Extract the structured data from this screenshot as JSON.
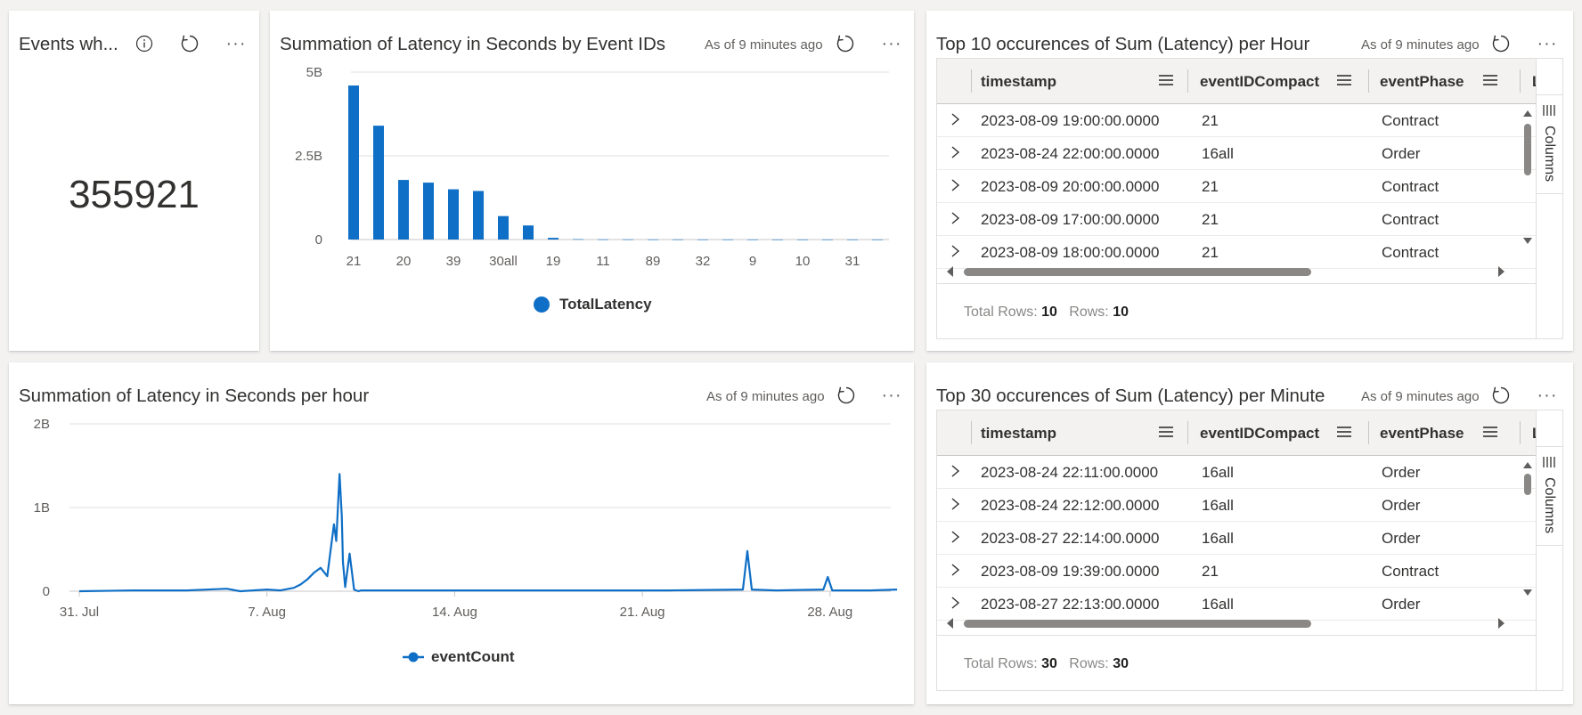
{
  "tiles": {
    "count": {
      "title": "Events wh...",
      "value": "355921"
    },
    "bar": {
      "title": "Summation of Latency in Seconds by Event IDs",
      "asof": "As of 9 minutes ago",
      "legend": "TotalLatency"
    },
    "line": {
      "title": "Summation of Latency in Seconds per hour",
      "asof": "As of 9 minutes ago",
      "legend": "eventCount"
    },
    "top10": {
      "title": "Top 10 occurences of Sum (Latency) per Hour",
      "asof": "As of 9 minutes ago",
      "columns": [
        "timestamp",
        "eventIDCompact",
        "eventPhase",
        "L"
      ],
      "side_tab": "Columns",
      "rows": [
        [
          "2023-08-09 19:00:00.0000",
          "21",
          "Contract"
        ],
        [
          "2023-08-24 22:00:00.0000",
          "16all",
          "Order"
        ],
        [
          "2023-08-09 20:00:00.0000",
          "21",
          "Contract"
        ],
        [
          "2023-08-09 17:00:00.0000",
          "21",
          "Contract"
        ],
        [
          "2023-08-09 18:00:00.0000",
          "21",
          "Contract"
        ]
      ],
      "footer": {
        "total_label": "Total Rows:",
        "total": "10",
        "rows_label": "Rows:",
        "rows": "10"
      }
    },
    "top30": {
      "title": "Top 30 occurences of Sum (Latency) per Minute",
      "asof": "As of 9 minutes ago",
      "columns": [
        "timestamp",
        "eventIDCompact",
        "eventPhase",
        "L"
      ],
      "side_tab": "Columns",
      "rows": [
        [
          "2023-08-24 22:11:00.0000",
          "16all",
          "Order"
        ],
        [
          "2023-08-24 22:12:00.0000",
          "16all",
          "Order"
        ],
        [
          "2023-08-27 22:14:00.0000",
          "16all",
          "Order"
        ],
        [
          "2023-08-09 19:39:00.0000",
          "21",
          "Contract"
        ],
        [
          "2023-08-27 22:13:00.0000",
          "16all",
          "Order"
        ]
      ],
      "footer": {
        "total_label": "Total Rows:",
        "total": "30",
        "rows_label": "Rows:",
        "rows": "30"
      }
    }
  },
  "icons": [
    "info-icon",
    "refresh-icon",
    "more-icon",
    "chevron-right-icon",
    "column-menu-icon",
    "columns-panel-icon",
    "scroll-up-icon",
    "scroll-down-icon",
    "scroll-left-icon",
    "scroll-right-icon"
  ],
  "colors": {
    "series": "#0f6fc6",
    "grid": "#e1dfdd",
    "accent": "#0078d4"
  },
  "chart_data": [
    {
      "type": "bar",
      "categories": [
        "21",
        "",
        "20",
        "",
        "39",
        "",
        "30all",
        "",
        "19",
        "",
        "11",
        "",
        "89",
        "",
        "32",
        "",
        "9",
        "",
        "10",
        "",
        "31",
        ""
      ],
      "series": [
        {
          "name": "TotalLatency",
          "values": [
            4.6,
            3.4,
            1.78,
            1.7,
            1.5,
            1.45,
            0.7,
            0.42,
            0.05,
            0.01,
            0.005,
            0.004,
            0.003,
            0.003,
            0.002,
            0.002,
            0.002,
            0.001,
            0.001,
            0.001,
            0.001,
            0.001
          ]
        }
      ],
      "y_ticks": [
        "5B",
        "2.5B",
        "0"
      ],
      "ylim": [
        0,
        5
      ],
      "y_unit": "B",
      "legend_position": "bottom"
    },
    {
      "type": "line",
      "x_ticks": [
        "31. Jul",
        "7. Aug",
        "14. Aug",
        "21. Aug",
        "28. Aug"
      ],
      "series": [
        {
          "name": "eventCount",
          "x": [
            "2023-07-31 00:00",
            "2023-08-02 00:00",
            "2023-08-04 00:00",
            "2023-08-05 12:00",
            "2023-08-06 00:00",
            "2023-08-07 00:00",
            "2023-08-07 12:00",
            "2023-08-08 00:00",
            "2023-08-08 06:00",
            "2023-08-08 12:00",
            "2023-08-08 18:00",
            "2023-08-09 00:00",
            "2023-08-09 06:00",
            "2023-08-09 12:00",
            "2023-08-09 14:00",
            "2023-08-09 17:00",
            "2023-08-09 19:00",
            "2023-08-09 20:00",
            "2023-08-09 22:00",
            "2023-08-10 02:00",
            "2023-08-10 06:00",
            "2023-08-10 08:00",
            "2023-08-10 10:00",
            "2023-08-10 12:00",
            "2023-08-11 00:00",
            "2023-08-13 00:00",
            "2023-08-16 00:00",
            "2023-08-19 00:00",
            "2023-08-22 00:00",
            "2023-08-24 18:00",
            "2023-08-24 22:00",
            "2023-08-25 02:00",
            "2023-08-26 00:00",
            "2023-08-27 18:00",
            "2023-08-27 22:00",
            "2023-08-28 02:00",
            "2023-08-29 12:00",
            "2023-08-30 12:00"
          ],
          "values": [
            0.0,
            0.01,
            0.01,
            0.03,
            0.0,
            0.02,
            0.01,
            0.04,
            0.08,
            0.14,
            0.22,
            0.28,
            0.18,
            0.8,
            0.6,
            1.4,
            0.9,
            0.35,
            0.05,
            0.45,
            0.02,
            0.01,
            0.0,
            0.01,
            0.01,
            0.01,
            0.01,
            0.01,
            0.01,
            0.02,
            0.48,
            0.02,
            0.01,
            0.02,
            0.17,
            0.01,
            0.01,
            0.02
          ]
        }
      ],
      "y_ticks": [
        "2B",
        "1B",
        "0"
      ],
      "ylim": [
        0,
        2
      ],
      "y_unit": "B",
      "legend_position": "bottom"
    }
  ]
}
